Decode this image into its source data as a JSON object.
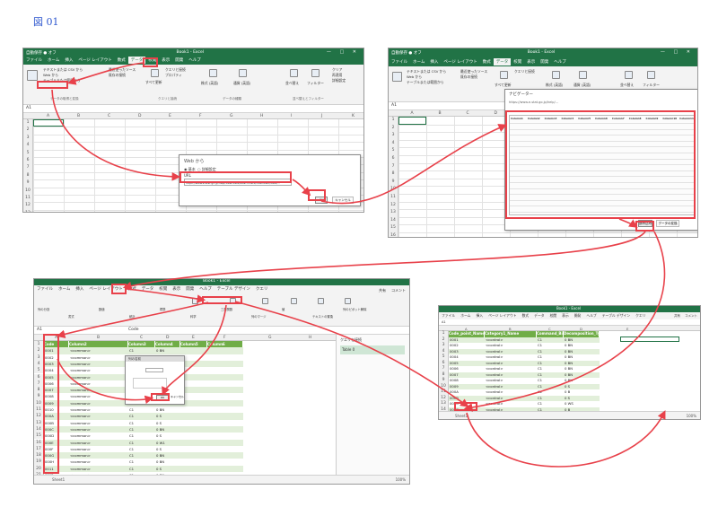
{
  "figure_label": "図 01",
  "colors": {
    "excel_green": "#217346",
    "highlight_red": "#e8414a",
    "table_header": "#70ad47",
    "band": "#e2efda",
    "figure_blue": "#2f58cf"
  },
  "window1": {
    "autosave": "自動保存 ● オフ",
    "title": "Book1 - Excel",
    "window_controls": "— □ ✕",
    "menu": [
      "ファイル",
      "ホーム",
      "挿入",
      "ページ レイアウト",
      "数式",
      "データ",
      "校閲",
      "表示",
      "開発",
      "ヘルプ"
    ],
    "active_menu_index": 5,
    "ribbon_buttons": [
      "テキストまたは CSV から",
      "Web から",
      "テーブルまたは範囲から",
      "最近使ったソース",
      "既存の接続",
      "すべて更新",
      "クエリと接続",
      "プロパティ",
      "株式 (英語)",
      "通貨 (英語)",
      "並べ替え",
      "フィルター",
      "クリア",
      "再適用",
      "詳細設定"
    ],
    "ribbon_groups": [
      "データの取得と変換",
      "クエリと接続",
      "データの種類",
      "並べ替えとフィルター"
    ],
    "name_box": "A1",
    "columns": [
      "A",
      "B",
      "C",
      "D",
      "E",
      "F",
      "G",
      "H",
      "I",
      "J",
      "K"
    ],
    "rows": [
      "1",
      "2",
      "3",
      "4",
      "5",
      "6",
      "7",
      "8",
      "9",
      "10",
      "11",
      "12",
      "13"
    ],
    "dialog": {
      "title": "Web から",
      "option_basic": "◉ 基本",
      "option_advanced": "○ 詳細設定",
      "url_label": "URL",
      "url_value": "https://www.e-stat.go.jp/help/view-data/Attachment/download/data/...",
      "ok": "OK",
      "cancel": "キャンセル"
    }
  },
  "window2": {
    "autosave": "自動保存 ● オフ",
    "title": "Book1 - Excel",
    "menu": [
      "ファイル",
      "ホーム",
      "挿入",
      "ページ レイアウト",
      "数式",
      "データ",
      "校閲",
      "表示",
      "開発",
      "ヘルプ"
    ],
    "ribbon_buttons": [
      "テキストまたは CSV から",
      "Web から",
      "テーブルまたは範囲から",
      "最近使ったソース",
      "既存の接続",
      "すべて更新",
      "クエリと接続",
      "株式 (英語)",
      "通貨 (英語)",
      "並べ替え",
      "フィルター"
    ],
    "name_box": "A1",
    "columns": [
      "A",
      "B",
      "C",
      "D",
      "E",
      "F",
      "G",
      "H",
      "I",
      "J",
      "K"
    ],
    "rows": [
      "1",
      "2",
      "3",
      "4",
      "5",
      "6",
      "7",
      "8",
      "9",
      "10",
      "11",
      "12",
      "13",
      "14",
      "15",
      "16"
    ],
    "navigator": {
      "title": "ナビゲーター",
      "url": "https://www.e-stat.go.jp/help/...",
      "load": "読み込み",
      "edit": "データの変換",
      "cancel": "キャンセル",
      "headers": [
        "Column1",
        "Column2",
        "Column3",
        "Column4",
        "Column5",
        "Column6",
        "Column7",
        "Column8",
        "Column9",
        "Column10",
        "Column11"
      ]
    }
  },
  "window3": {
    "title": "Book1 - Excel",
    "menu": [
      "ファイル",
      "ホーム",
      "挿入",
      "ページ レイアウト",
      "数式",
      "データ",
      "校閲",
      "表示",
      "開発",
      "ヘルプ",
      "テーブル デザイン",
      "クエリ"
    ],
    "share": "共有",
    "comment": "コメント",
    "ribbon_buttons": [
      "列の分割",
      "書式",
      "数値",
      "統計",
      "標準",
      "科学",
      "三角関数",
      "列のマージ",
      "値",
      "テキストの置換",
      "列のピボット解除"
    ],
    "name_box": "A1",
    "formula": "Code",
    "columns": [
      "A",
      "B",
      "C",
      "D",
      "E",
      "F",
      "G",
      "H"
    ],
    "header_cells": [
      "Code",
      "Column2",
      "Column3",
      "Column4",
      "Column5",
      "Column6"
    ],
    "rows": [
      {
        "n": "2",
        "a": "0001",
        "b": "<common>",
        "c": "C1",
        "d": "0",
        "e": "BN"
      },
      {
        "n": "3",
        "a": "0002",
        "b": "<common>",
        "c": "C1",
        "d": "0",
        "e": "BN"
      },
      {
        "n": "4",
        "a": "0003",
        "b": "<common>",
        "c": "C1",
        "d": "0",
        "e": "BN"
      },
      {
        "n": "5",
        "a": "0004",
        "b": "<common>",
        "c": "C1",
        "d": "0",
        "e": "BN"
      },
      {
        "n": "6",
        "a": "0005",
        "b": "<common>",
        "c": "C1",
        "d": "0",
        "e": "BN"
      },
      {
        "n": "7",
        "a": "0006",
        "b": "<common>",
        "c": "C1",
        "d": "0",
        "e": "BN"
      },
      {
        "n": "8",
        "a": "0007",
        "b": "<common>",
        "c": "C1",
        "d": "0",
        "e": "BN"
      },
      {
        "n": "9",
        "a": "0008",
        "b": "<common>",
        "c": "C1",
        "d": "0",
        "e": "BN"
      },
      {
        "n": "10",
        "a": "0009",
        "b": "<common>",
        "c": "C1",
        "d": "0",
        "e": "BN"
      },
      {
        "n": "11",
        "a": "0010",
        "b": "<common>",
        "c": "C1",
        "d": "0",
        "e": "BN"
      },
      {
        "n": "12",
        "a": "000A",
        "b": "<common>",
        "c": "C1",
        "d": "0",
        "e": "S"
      },
      {
        "n": "13",
        "a": "000B",
        "b": "<common>",
        "c": "C1",
        "d": "0",
        "e": "S"
      },
      {
        "n": "14",
        "a": "000C",
        "b": "<common>",
        "c": "C1",
        "d": "0",
        "e": "BN"
      },
      {
        "n": "15",
        "a": "000D",
        "b": "<common>",
        "c": "C1",
        "d": "0",
        "e": "S"
      },
      {
        "n": "16",
        "a": "000E",
        "b": "<common>",
        "c": "C1",
        "d": "0",
        "e": "W1"
      },
      {
        "n": "17",
        "a": "000F",
        "b": "<common>",
        "c": "C1",
        "d": "0",
        "e": "S"
      },
      {
        "n": "18",
        "a": "000G",
        "b": "<common>",
        "c": "C1",
        "d": "0",
        "e": "BN"
      },
      {
        "n": "19",
        "a": "000H",
        "b": "<common>",
        "c": "C1",
        "d": "0",
        "e": "BN"
      },
      {
        "n": "20",
        "a": "0011",
        "b": "<common>",
        "c": "C1",
        "d": "0",
        "e": "S"
      },
      {
        "n": "21",
        "a": "0012",
        "b": "<common>",
        "c": "C1",
        "d": "0",
        "e": "BN"
      }
    ],
    "dialog": {
      "title": "列の名前",
      "ok": "OK",
      "cancel": "キャンセル"
    },
    "pane_title": "クエリと接続",
    "pane_item": "Table 0",
    "sheet_tab": "Sheet1",
    "zoom": "100%"
  },
  "window4": {
    "title": "Book1 - Excel",
    "menu": [
      "ファイル",
      "ホーム",
      "挿入",
      "ページ レイアウト",
      "数式",
      "データ",
      "校閲",
      "表示",
      "開発",
      "ヘルプ",
      "テーブル デザイン",
      "クエリ"
    ],
    "share": "共有",
    "comment": "コメント",
    "name_box": "A1",
    "columns": [
      "A",
      "B",
      "C",
      "D",
      "E"
    ],
    "header_cells": [
      "Code_point_Name",
      "Category1_Name",
      "Command_Bidi_Class",
      "Decomposition_Type"
    ],
    "rows": [
      {
        "n": "2",
        "a": "0001",
        "b": "<control>",
        "c": "C1",
        "d": "0",
        "e": "BN"
      },
      {
        "n": "3",
        "a": "0002",
        "b": "<control>",
        "c": "C1",
        "d": "0",
        "e": "BN"
      },
      {
        "n": "4",
        "a": "0003",
        "b": "<control>",
        "c": "C1",
        "d": "0",
        "e": "BN"
      },
      {
        "n": "5",
        "a": "0004",
        "b": "<control>",
        "c": "C1",
        "d": "0",
        "e": "BN"
      },
      {
        "n": "6",
        "a": "0005",
        "b": "<control>",
        "c": "C1",
        "d": "0",
        "e": "BN"
      },
      {
        "n": "7",
        "a": "0006",
        "b": "<control>",
        "c": "C1",
        "d": "0",
        "e": "BN"
      },
      {
        "n": "8",
        "a": "0007",
        "b": "<control>",
        "c": "C1",
        "d": "0",
        "e": "BN"
      },
      {
        "n": "9",
        "a": "0008",
        "b": "<control>",
        "c": "C1",
        "d": "0",
        "e": "BN"
      },
      {
        "n": "10",
        "a": "0009",
        "b": "<control>",
        "c": "C1",
        "d": "0",
        "e": "S"
      },
      {
        "n": "11",
        "a": "000A",
        "b": "<control>",
        "c": "C1",
        "d": "0",
        "e": "B"
      },
      {
        "n": "12",
        "a": "000B",
        "b": "<control>",
        "c": "C1",
        "d": "0",
        "e": "S"
      },
      {
        "n": "13",
        "a": "000C",
        "b": "<control>",
        "c": "C1",
        "d": "0",
        "e": "WS"
      },
      {
        "n": "14",
        "a": "000D",
        "b": "<control>",
        "c": "C1",
        "d": "0",
        "e": "B"
      },
      {
        "n": "15",
        "a": "000E",
        "b": "<control>",
        "c": "C1",
        "d": "0",
        "e": "BN"
      }
    ],
    "sheet_tab": "Sheet1",
    "zoom": "100%"
  }
}
